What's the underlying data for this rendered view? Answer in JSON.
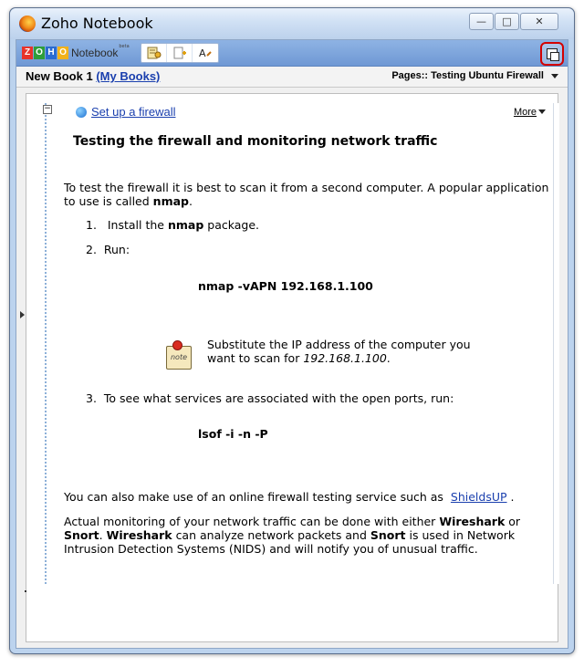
{
  "window": {
    "title": "Zoho Notebook",
    "controls": [
      "minimize",
      "maximize",
      "close"
    ]
  },
  "toolbar": {
    "logo_letters": [
      "Z",
      "O",
      "H",
      "O"
    ],
    "logo_colors": [
      "#e8332a",
      "#2e9d3a",
      "#2a6bd1",
      "#f2b21a"
    ],
    "logo_word": "Notebook",
    "logo_beta": "beta",
    "icons": [
      "notebook-icon",
      "add-page-icon",
      "font-icon"
    ],
    "popout_icon": "popout-icon"
  },
  "bookbar": {
    "book_name": "New Book 1",
    "my_books_link": "(My Books)",
    "pages_label": "Pages:: Testing Ubuntu Firewall"
  },
  "content": {
    "setup_link": "Set up a firewall",
    "more_label": "More",
    "heading": "Testing the firewall and monitoring network traffic",
    "intro_text": "To test the firewall it is best to scan it from a second computer. A popular application to use is called",
    "intro_bold": "nmap",
    "intro_end": ".",
    "step1_num": "1.",
    "step1_text": "Install the",
    "step1_bold": "nmap",
    "step1_end": "package.",
    "step2_num": "2.",
    "step2_text": "Run:",
    "nmap_command": "nmap -vAPN 192.168.1.100",
    "note_label": "note",
    "note_text_1": "Substitute the IP address of the computer you",
    "note_text_2": "want to scan for",
    "note_ip": "192.168.1.100",
    "note_end": ".",
    "step3_num": "3.",
    "step3_text": "To see what services are associated with the open ports, run:",
    "lsof_command": "lsof -i -n -P",
    "online_text": "You can also make use of an online firewall testing service such as",
    "shieldsup_link": "ShieldsUP",
    "online_end": ".",
    "monitor_text_1": "Actual monitoring of your network traffic can be done with either",
    "monitor_wireshark": "Wireshark",
    "monitor_or": "or",
    "monitor_snort": "Snort",
    "monitor_dot": ".",
    "monitor_wireshark2": "Wireshark",
    "monitor_text_2": "can analyze network packets and",
    "monitor_snort2": "Snort",
    "monitor_text_3": "is used in Network Intrusion Detection Systems (NIDS) and will notify you of unusual traffic."
  }
}
